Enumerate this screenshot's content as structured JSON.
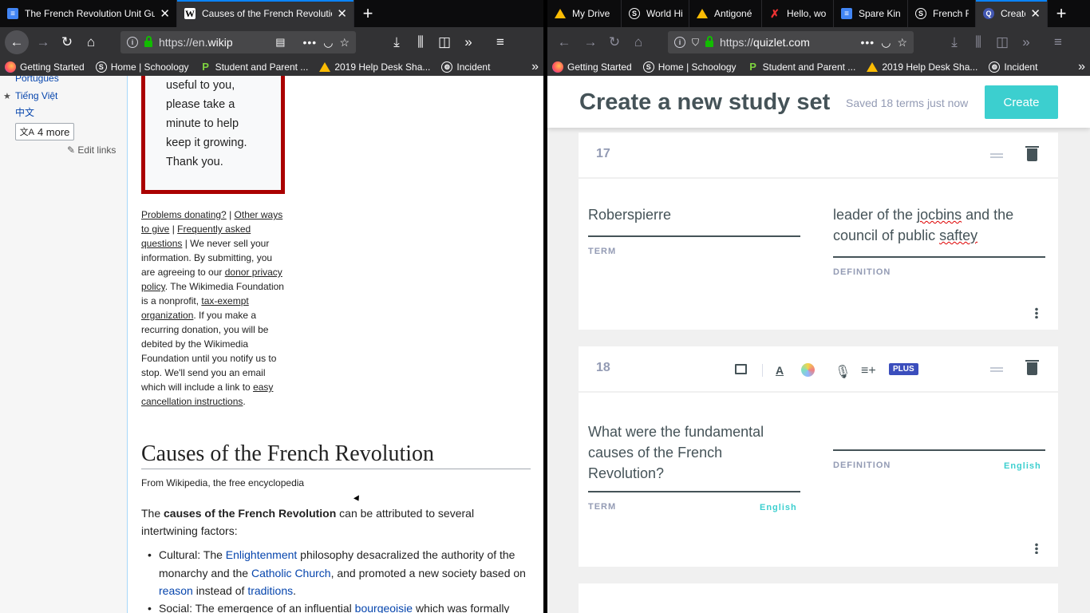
{
  "left": {
    "tabs": [
      {
        "label": "The French Revolution Unit Gui",
        "icon": "google-docs-icon",
        "active": false
      },
      {
        "label": "Causes of the French Revolutio",
        "icon": "wikipedia-icon",
        "active": true
      }
    ],
    "url": {
      "dim": "https://en.",
      "strong": "wikip"
    },
    "bookmarks": [
      {
        "label": "Getting Started",
        "icon": "firefox-icon"
      },
      {
        "label": "Home | Schoology",
        "icon": "schoology-icon"
      },
      {
        "label": "Student and Parent ...",
        "icon": "parent-portal-icon"
      },
      {
        "label": "2019 Help Desk Sha...",
        "icon": "google-drive-icon"
      },
      {
        "label": "Incident",
        "icon": "globe-icon"
      }
    ],
    "sidebar": {
      "lang_cut": "Português",
      "lang_vi": "Tiếng Việt",
      "lang_zh": "中文",
      "more_label": "4 more",
      "edit_links": "Edit links"
    },
    "donate": {
      "lines": [
        "useful to you,",
        "please take a",
        "minute to help",
        "keep it growing.",
        "Thank you."
      ]
    },
    "fineprint": {
      "problems": "Problems donating?",
      "sep1": " | ",
      "other": "Other ways to give",
      "sep2": " | ",
      "faq": "Frequently asked questions",
      "t1": " | We never sell your information. By submitting, you are agreeing to our ",
      "privacy": "donor privacy policy",
      "t2": ". The Wikimedia Foundation is a nonprofit, ",
      "taxexempt": "tax-exempt organization",
      "t3": ". If you make a recurring donation, you will be debited by the Wikimedia Foundation until you notify us to stop. We'll send you an email which will include a link to ",
      "cancel": "easy cancellation instructions",
      "t4": "."
    },
    "article": {
      "title": "Causes of the French Revolution",
      "from": "From Wikipedia, the free encyclopedia",
      "intro_a": "The ",
      "intro_bold": "causes of the French Revolution",
      "intro_b": " can be attributed to several intertwining factors:",
      "b1_a": "Cultural: The ",
      "b1_link1": "Enlightenment",
      "b1_b": " philosophy desacralized the authority of the monarchy and the ",
      "b1_link2": "Catholic Church",
      "b1_c": ", and promoted a new society based on ",
      "b1_link3": "reason",
      "b1_d": " instead of ",
      "b1_link4": "traditions",
      "b1_e": ".",
      "b2_a": "Social: The emergence of an influential ",
      "b2_link": "bourgeoisie",
      "b2_b": " which was formally"
    }
  },
  "right": {
    "tabs": [
      {
        "label": "My Drive",
        "icon": "google-drive-icon"
      },
      {
        "label": "World His",
        "icon": "schoology-icon"
      },
      {
        "label": "Antigoné",
        "icon": "google-drive-icon"
      },
      {
        "label": "Hello, wo",
        "icon": "red-figure-icon"
      },
      {
        "label": "Spare Kin",
        "icon": "google-docs-icon"
      },
      {
        "label": "French Re",
        "icon": "schoology-icon"
      },
      {
        "label": "Create",
        "icon": "quizlet-icon",
        "active": true
      }
    ],
    "url": {
      "dim": "https://",
      "strong": "quizlet.com"
    },
    "bookmarks": [
      {
        "label": "Getting Started",
        "icon": "firefox-icon"
      },
      {
        "label": "Home | Schoology",
        "icon": "schoology-icon"
      },
      {
        "label": "Student and Parent ...",
        "icon": "parent-portal-icon"
      },
      {
        "label": "2019 Help Desk Sha...",
        "icon": "google-drive-icon"
      },
      {
        "label": "Incident",
        "icon": "globe-icon"
      }
    ],
    "header": {
      "title": "Create a new study set",
      "saved": "Saved 18 terms just now",
      "create": "Create"
    },
    "cards": [
      {
        "number": "17",
        "term": "Roberspierre",
        "def_a": "leader of the ",
        "def_err1": "jocbins",
        "def_b": " and the council of public ",
        "def_err2": "saftey",
        "term_label": "TERM",
        "def_label": "DEFINITION"
      },
      {
        "number": "18",
        "term": "What were the fundamental causes of the French Revolution?",
        "definition": "",
        "term_label": "TERM",
        "def_label": "DEFINITION",
        "term_lang": "English",
        "def_lang": "English",
        "plus_badge": "PLUS"
      }
    ]
  }
}
